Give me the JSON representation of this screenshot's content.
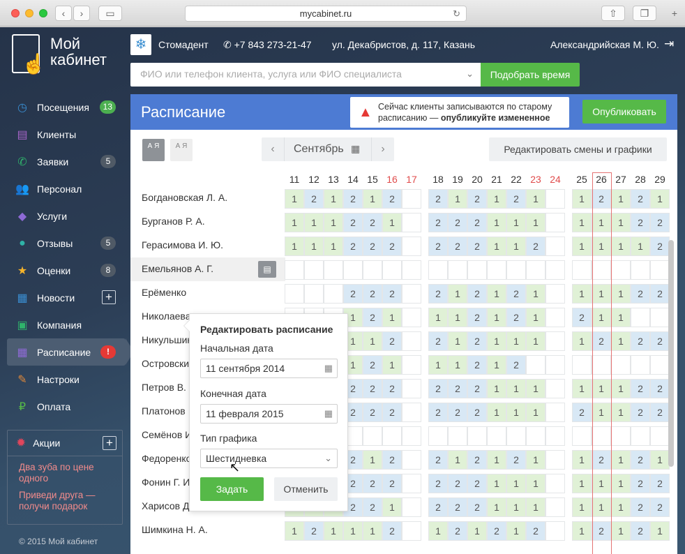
{
  "browser": {
    "url": "mycabinet.ru"
  },
  "sidebar": {
    "logo_line1": "Мой",
    "logo_line2": "кабинет",
    "items": [
      {
        "label": "Посещения",
        "icon": "clock-icon",
        "badge": "13",
        "badge_style": "green",
        "glyph": "◷",
        "color": "#3a8ed1"
      },
      {
        "label": "Клиенты",
        "icon": "clients-icon",
        "badge": "",
        "glyph": "▤",
        "color": "#a765c9"
      },
      {
        "label": "Заявки",
        "icon": "phone-icon",
        "badge": "5",
        "glyph": "✆",
        "color": "#2fb36b"
      },
      {
        "label": "Персонал",
        "icon": "staff-icon",
        "badge": "",
        "glyph": "👥",
        "color": "#e0883a"
      },
      {
        "label": "Услуги",
        "icon": "tag-icon",
        "badge": "",
        "glyph": "◆",
        "color": "#8e6ad6"
      },
      {
        "label": "Отзывы",
        "icon": "chat-icon",
        "badge": "5",
        "glyph": "●",
        "color": "#2fb3a8"
      },
      {
        "label": "Оценки",
        "icon": "star-icon",
        "badge": "8",
        "glyph": "★",
        "color": "#f5b32a"
      },
      {
        "label": "Новости",
        "icon": "news-icon",
        "badge": "",
        "plus": true,
        "glyph": "▦",
        "color": "#3a8ed1"
      },
      {
        "label": "Компания",
        "icon": "briefcase-icon",
        "badge": "",
        "glyph": "▣",
        "color": "#2fb36b"
      },
      {
        "label": "Расписание",
        "icon": "calendar-icon",
        "badge": "!",
        "badge_style": "red",
        "active": true,
        "glyph": "▦",
        "color": "#8e6ad6"
      },
      {
        "label": "Настроки",
        "icon": "wrench-icon",
        "badge": "",
        "glyph": "✎",
        "color": "#e0883a"
      },
      {
        "label": "Оплата",
        "icon": "ruble-icon",
        "badge": "",
        "glyph": "₽",
        "color": "#56b948"
      }
    ],
    "promo": {
      "title": "Акции",
      "links": [
        "Два зуба по цене одного",
        "Приведи друга — получи подарок"
      ]
    },
    "copyright": "© 2015 Мой кабинет"
  },
  "topbar": {
    "clinic": "Стомадент",
    "phone": "+7 843 273-21-47",
    "address": "ул. Декабристов, д. 117, Казань",
    "user": "Александрийская М. Ю."
  },
  "search": {
    "placeholder": "ФИО или телефон клиента, услуга или ФИО специалиста",
    "button": "Подобрать время"
  },
  "panel": {
    "title": "Расписание",
    "warning_text": "Сейчас клиенты записываются по старому расписанию — ",
    "warning_bold": "опубликуйте измененное",
    "publish": "Опубликовать",
    "month": "Сентябрь",
    "edit_shifts": "Редактировать смены и графики",
    "sort_label": "А Я"
  },
  "schedule": {
    "weeks": [
      {
        "days": [
          "11",
          "12",
          "13",
          "14",
          "15",
          "16",
          "17"
        ],
        "weekend": [
          5,
          6
        ]
      },
      {
        "days": [
          "18",
          "19",
          "20",
          "21",
          "22",
          "23",
          "24"
        ],
        "weekend": [
          5,
          6
        ]
      },
      {
        "days": [
          "25",
          "26",
          "27",
          "28",
          "29"
        ],
        "weekend": []
      }
    ],
    "today_day": "26",
    "rows": [
      {
        "name": "Богдановская Л. А.",
        "w": [
          [
            "1",
            "2",
            "1",
            "2",
            "1",
            "2",
            ""
          ],
          [
            "2",
            "1",
            "2",
            "1",
            "2",
            "1",
            ""
          ],
          [
            "1",
            "2",
            "1",
            "2",
            "1"
          ]
        ]
      },
      {
        "name": "Бурганов Р. А.",
        "w": [
          [
            "1",
            "1",
            "1",
            "2",
            "2",
            "1",
            ""
          ],
          [
            "2",
            "2",
            "2",
            "1",
            "1",
            "1",
            ""
          ],
          [
            "1",
            "1",
            "1",
            "2",
            "2"
          ]
        ]
      },
      {
        "name": "Герасимова И. Ю.",
        "w": [
          [
            "1",
            "1",
            "1",
            "2",
            "2",
            "2",
            ""
          ],
          [
            "2",
            "2",
            "2",
            "1",
            "1",
            "2",
            ""
          ],
          [
            "1",
            "1",
            "1",
            "1",
            "2"
          ]
        ]
      },
      {
        "name": "Емельянов А. Г.",
        "highlight": true,
        "w": [
          [
            "",
            "",
            "",
            "",
            "",
            "",
            ""
          ],
          [
            "",
            "",
            "",
            "",
            "",
            "",
            ""
          ],
          [
            "",
            "",
            "",
            "",
            ""
          ]
        ]
      },
      {
        "name": "Ерёменко",
        "w": [
          [
            "",
            "",
            "",
            "2",
            "2",
            "2",
            ""
          ],
          [
            "2",
            "1",
            "2",
            "1",
            "2",
            "1",
            ""
          ],
          [
            "1",
            "1",
            "1",
            "2",
            "2"
          ]
        ]
      },
      {
        "name": "Николаева",
        "w": [
          [
            "",
            "",
            "",
            "1",
            "2",
            "1",
            ""
          ],
          [
            "1",
            "1",
            "2",
            "1",
            "2",
            "1",
            ""
          ],
          [
            "2",
            "1",
            "1",
            "",
            ""
          ]
        ]
      },
      {
        "name": "Никульшин",
        "w": [
          [
            "",
            "",
            "",
            "1",
            "1",
            "2",
            ""
          ],
          [
            "2",
            "1",
            "2",
            "1",
            "1",
            "1",
            ""
          ],
          [
            "1",
            "2",
            "1",
            "2",
            "2"
          ]
        ]
      },
      {
        "name": "Островски",
        "w": [
          [
            "",
            "",
            "",
            "1",
            "2",
            "1",
            ""
          ],
          [
            "1",
            "1",
            "2",
            "1",
            "2",
            "",
            ""
          ],
          [
            "",
            "",
            "",
            "",
            ""
          ]
        ]
      },
      {
        "name": "Петров В. Н.",
        "w": [
          [
            "",
            "",
            "",
            "2",
            "2",
            "2",
            ""
          ],
          [
            "2",
            "2",
            "2",
            "1",
            "1",
            "1",
            ""
          ],
          [
            "1",
            "1",
            "1",
            "2",
            "2"
          ]
        ]
      },
      {
        "name": "Платонов",
        "w": [
          [
            "",
            "",
            "",
            "2",
            "2",
            "2",
            ""
          ],
          [
            "2",
            "2",
            "2",
            "1",
            "1",
            "1",
            ""
          ],
          [
            "2",
            "1",
            "1",
            "2",
            "2"
          ]
        ]
      },
      {
        "name": "Семёнов И",
        "w": [
          [
            "",
            "",
            "",
            "",
            "",
            "",
            ""
          ],
          [
            "",
            "",
            "",
            "",
            "",
            "",
            ""
          ],
          [
            "",
            "",
            "",
            "",
            ""
          ]
        ]
      },
      {
        "name": "Федоренко",
        "w": [
          [
            "",
            "",
            "",
            "2",
            "1",
            "2",
            ""
          ],
          [
            "2",
            "1",
            "2",
            "1",
            "2",
            "1",
            ""
          ],
          [
            "1",
            "2",
            "1",
            "2",
            "1"
          ]
        ]
      },
      {
        "name": "Фонин Г. И.",
        "w": [
          [
            "1",
            "1",
            "1",
            "2",
            "2",
            "2",
            ""
          ],
          [
            "2",
            "2",
            "2",
            "1",
            "1",
            "1",
            ""
          ],
          [
            "1",
            "1",
            "1",
            "2",
            "2"
          ]
        ]
      },
      {
        "name": "Харисов Д. Л.",
        "w": [
          [
            "1",
            "1",
            "1",
            "2",
            "2",
            "1",
            ""
          ],
          [
            "2",
            "2",
            "2",
            "1",
            "1",
            "1",
            ""
          ],
          [
            "1",
            "1",
            "1",
            "2",
            "2"
          ]
        ]
      },
      {
        "name": "Шимкина Н. А.",
        "w": [
          [
            "1",
            "2",
            "1",
            "1",
            "1",
            "2",
            ""
          ],
          [
            "1",
            "2",
            "1",
            "2",
            "1",
            "2",
            ""
          ],
          [
            "1",
            "2",
            "1",
            "2",
            "1"
          ]
        ]
      }
    ]
  },
  "popup": {
    "title": "Редактировать расписание",
    "start_label": "Начальная дата",
    "start_value": "11 сентября 2014",
    "end_label": "Конечная дата",
    "end_value": "11 февраля 2015",
    "type_label": "Тип графика",
    "type_value": "Шестидневка",
    "apply": "Задать",
    "cancel": "Отменить"
  }
}
